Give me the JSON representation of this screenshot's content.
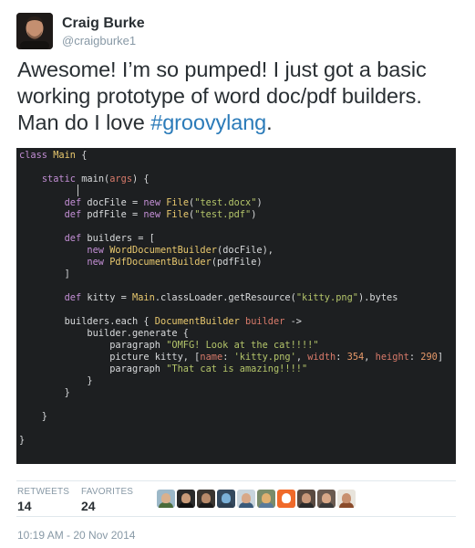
{
  "author": {
    "name": "Craig Burke",
    "handle": "@craigburke1"
  },
  "tweet": {
    "text_before": "Awesome! I’m so pumped! I just got a basic working prototype of word doc/pdf builders. Man do I love ",
    "hashtag": "#groovylang",
    "text_after": "."
  },
  "code_image": {
    "background": "#1d1f21",
    "lines": [
      "class Main {",
      "",
      "    static main(args) {",
      "",
      "        def docFile = new File(\"test.docx\")",
      "        def pdfFile = new File(\"test.pdf\")",
      "",
      "        def builders = [",
      "            new WordDocumentBuilder(docFile),",
      "            new PdfDocumentBuilder(pdfFile)",
      "        ]",
      "",
      "        def kitty = Main.classLoader.getResource(\"kitty.png\").bytes",
      "",
      "        builders.each { DocumentBuilder builder ->",
      "            builder.generate {",
      "                paragraph \"OMFG! Look at the cat!!!!\"",
      "                picture kitty, [name: 'kitty.png', width: 354, height: 290]",
      "                paragraph \"That cat is amazing!!!!\"",
      "            }",
      "        }",
      "",
      "    }",
      "",
      "}"
    ]
  },
  "stats": {
    "retweets_label": "RETWEETS",
    "retweets_count": "14",
    "favorites_label": "FAVORITES",
    "favorites_count": "24"
  },
  "favoriters": [
    {
      "bg": "#9cb8c8",
      "skin": "#d9b08c",
      "shirt": "#4a6b3a"
    },
    {
      "bg": "#2a2a2a",
      "skin": "#c89a78",
      "shirt": "#111111"
    },
    {
      "bg": "#3a3530",
      "skin": "#b88a6a",
      "shirt": "#1a1a1a"
    },
    {
      "bg": "#34495e",
      "skin": "#7ab0d8",
      "shirt": "#2c3e50"
    },
    {
      "bg": "#c8d4dc",
      "skin": "#d8a888",
      "shirt": "#3a5a7a"
    },
    {
      "bg": "#7a8c6a",
      "skin": "#e0b070",
      "shirt": "#5a7a9a"
    },
    {
      "bg": "#f06a2a",
      "skin": "#ffffff",
      "shirt": "#f06a2a"
    },
    {
      "bg": "#5a4a40",
      "skin": "#c8987a",
      "shirt": "#2a2a2a"
    },
    {
      "bg": "#6a5a50",
      "skin": "#d8a888",
      "shirt": "#3a3a3a"
    },
    {
      "bg": "#e8e4dc",
      "skin": "#c89070",
      "shirt": "#8a4a2a"
    }
  ],
  "timestamp": "10:19 AM - 20 Nov 2014"
}
